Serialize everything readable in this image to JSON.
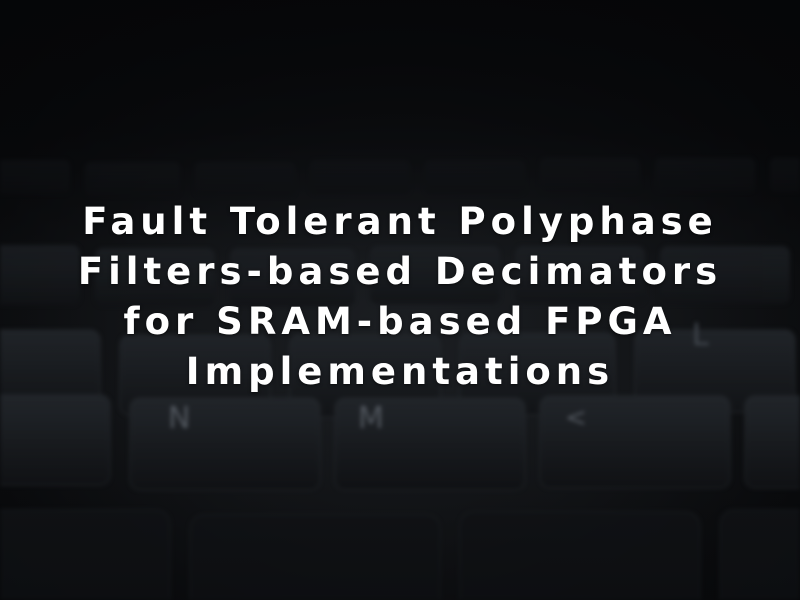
{
  "background": {
    "subject": "keyboard-photo",
    "colors": {
      "base": "#0b0c0e",
      "key": "#1b1e22",
      "key_edge": "#2a2e33",
      "legend": "#5a6068"
    },
    "key_legends": [
      "N",
      "M",
      "<",
      "L"
    ]
  },
  "title": {
    "lines": [
      "Fault Tolerant Polyphase",
      "Filters-based Decimators",
      "for SRAM-based FPGA",
      "Implementations"
    ],
    "color": "#ffffff"
  }
}
